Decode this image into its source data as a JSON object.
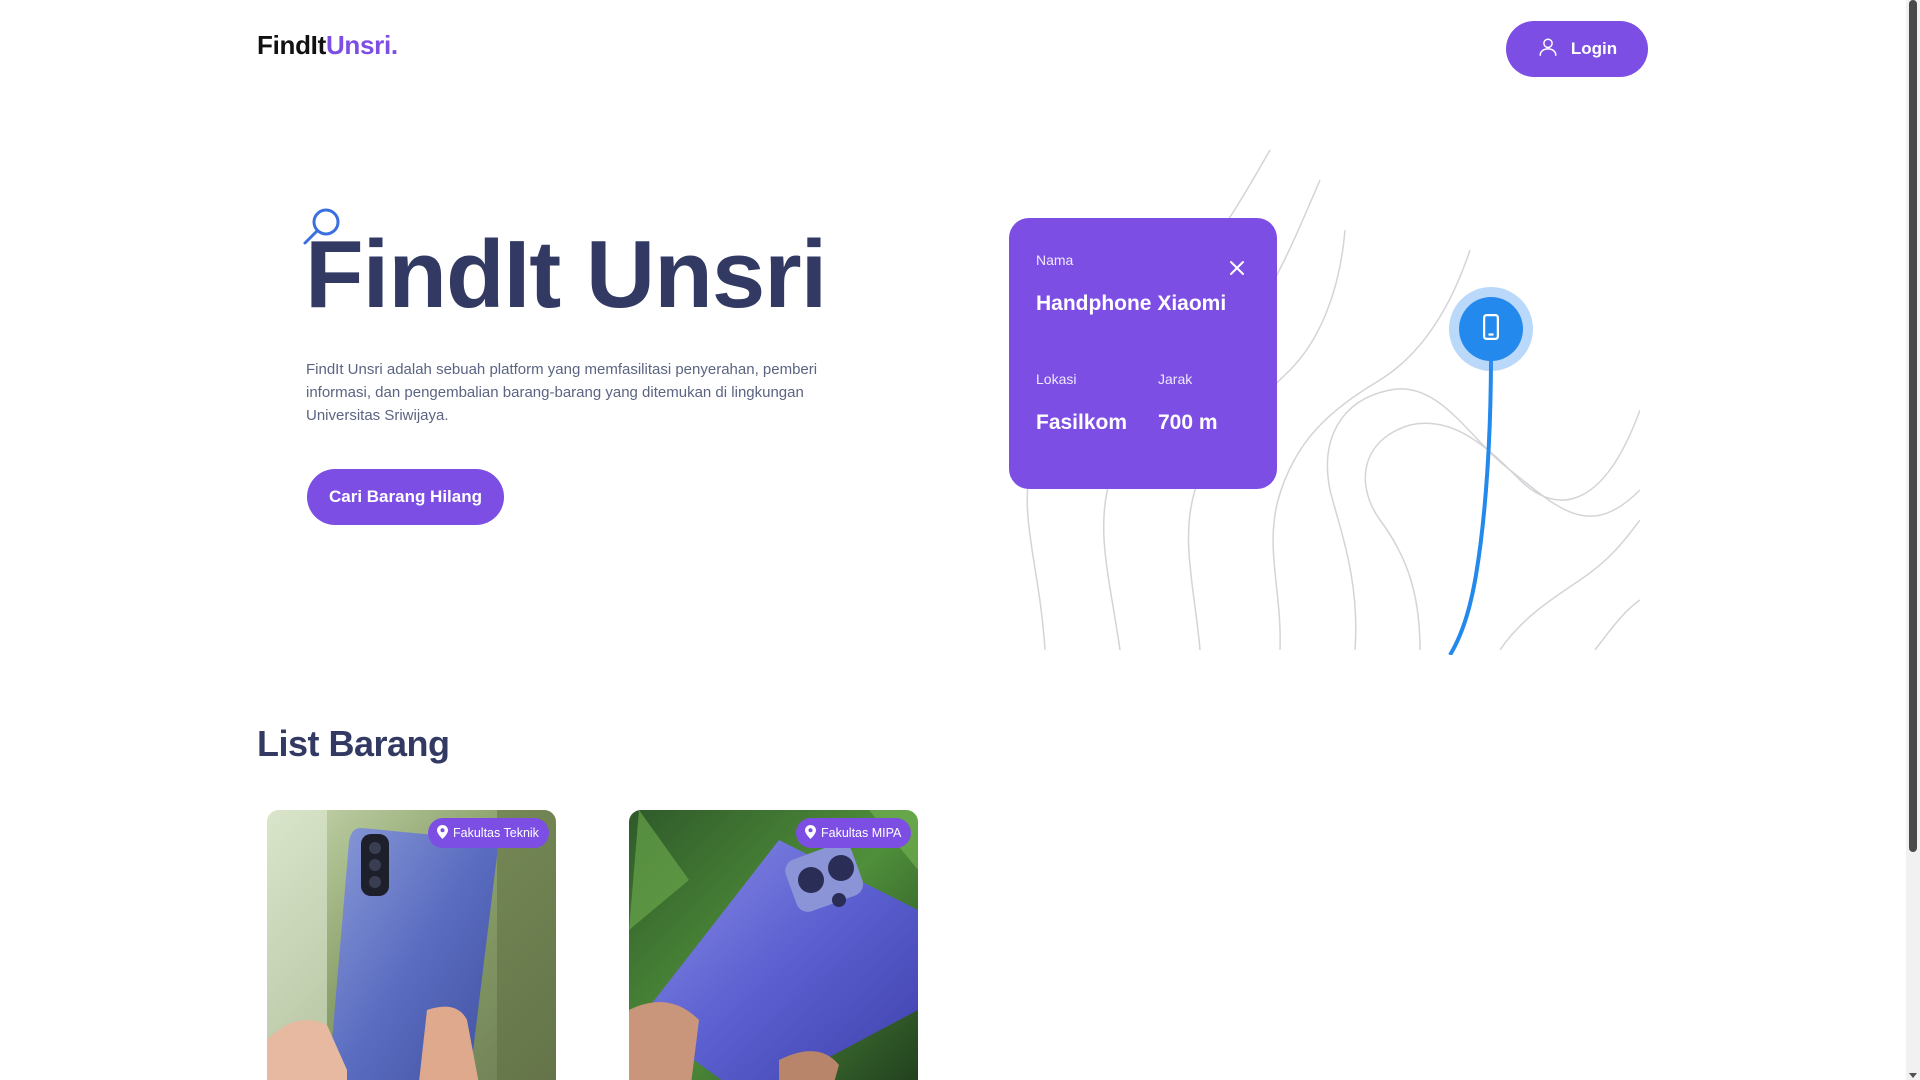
{
  "header": {
    "brand_part1": "FindIt",
    "brand_part2": "Unsri.",
    "login_label": "Login"
  },
  "hero": {
    "title": "FindIt Unsri",
    "description": "FindIt Unsri adalah sebuah platform yang memfasilitasi penyerahan, pemberi informasi, dan pengembalian barang-barang yang ditemukan di lingkungan Universitas Sriwijaya.",
    "cta_label": "Cari Barang Hilang"
  },
  "info_card": {
    "name_label": "Nama",
    "name_value": "Handphone Xiaomi",
    "location_label": "Lokasi",
    "location_value": "Fasilkom",
    "distance_label": "Jarak",
    "distance_value": "700 m"
  },
  "list_section": {
    "title": "List Barang",
    "items": [
      {
        "location": "Fakultas Teknik",
        "photo": "phone-samsung-blue"
      },
      {
        "location": "Fakultas MIPA",
        "photo": "phone-redmi-purple"
      }
    ]
  },
  "icons": {
    "login": "user-icon",
    "hero": "search-icon",
    "card_close": "close-icon",
    "map_pin": "smartphone-icon",
    "badge": "map-pin-icon"
  },
  "colors": {
    "accent": "#7c4ee4",
    "heading": "#323a64",
    "pin": "#2489ec"
  }
}
